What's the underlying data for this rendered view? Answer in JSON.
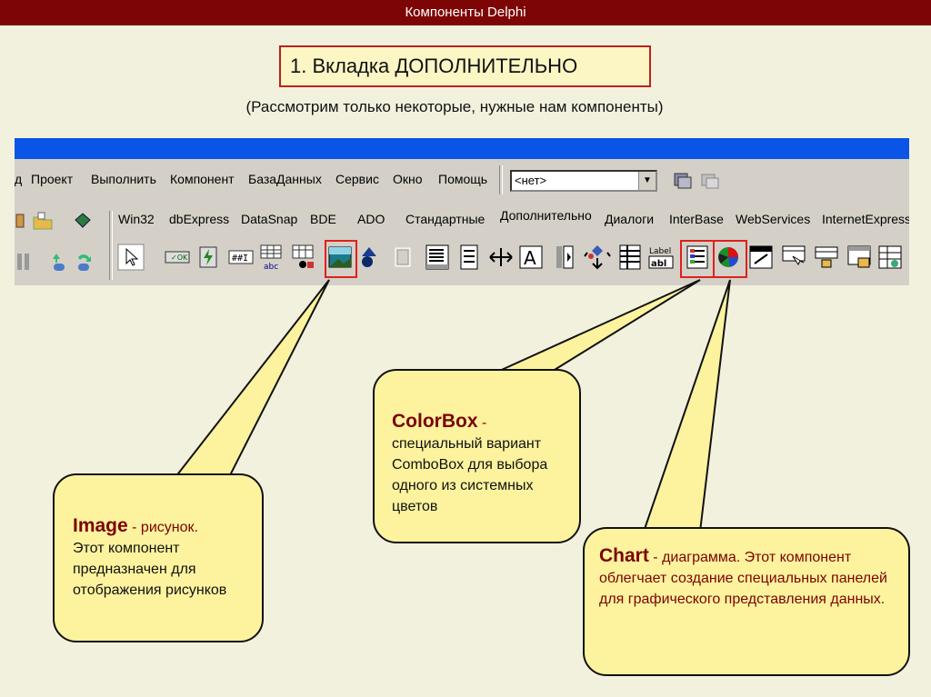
{
  "header": {
    "title": "Компоненты Delphi"
  },
  "section_title": "1. Вкладка ДОПОЛНИТЕЛЬНО",
  "subtitle": "(Рассмотрим только некоторые, нужные нам компоненты)",
  "delphi": {
    "menu": [
      "д",
      "Проект",
      "Выполнить",
      "Компонент",
      "БазаДанных",
      "Сервис",
      "Окно",
      "Помощь"
    ],
    "config_combo": {
      "value": "<нет>"
    },
    "tabs": [
      "Win32",
      "dbExpress",
      "DataSnap",
      "BDE",
      "ADO",
      "Стандартные",
      "Дополнительно",
      "Диалоги",
      "InterBase",
      "WebServices",
      "InternetExpress"
    ],
    "active_tab": "Дополнительно",
    "palette_labels": {
      "label_icon": "Label",
      "abc": "abc",
      "abl": "abl"
    }
  },
  "callouts": {
    "image": {
      "keyword": "Image",
      "dash": " - рисунок.",
      "body": "Этот компонент предназначен для отображения рисунков"
    },
    "colorbox": {
      "keyword": "ColorBox",
      "dash": " -",
      "body": "специальный вариант ComboBox для выбора одного из системных цветов"
    },
    "chart": {
      "keyword": "Chart",
      "dash": " - диаграмма. Этот компонент облегчает создание специальных панелей для графического представления данных."
    }
  },
  "colors": {
    "accent": "#7e0505",
    "callout_bg": "#fdf39e",
    "highlight": "#e0201b"
  }
}
